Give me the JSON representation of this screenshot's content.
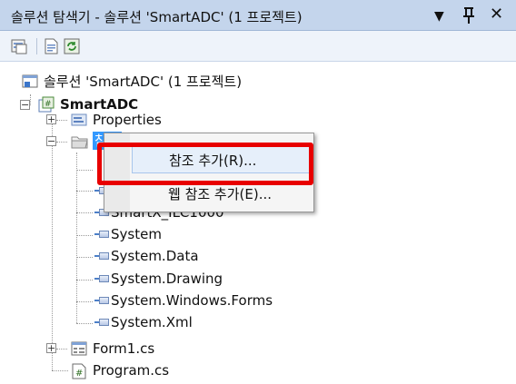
{
  "window": {
    "title": "솔루션 탐색기 - 솔루션 'SmartADC' (1 프로젝트)"
  },
  "title_controls": {
    "dropdown": "▼",
    "pin": "Ț",
    "close": "✕"
  },
  "tree": {
    "solution": "솔루션 'SmartADC' (1 프로젝트)",
    "project": "SmartADC",
    "properties": "Properties",
    "references": "참조",
    "reference_items": [
      "SmartX_ILC1000",
      "System",
      "System.Data",
      "System.Drawing",
      "System.Windows.Forms",
      "System.Xml"
    ],
    "form1": "Form1.cs",
    "program": "Program.cs"
  },
  "context_menu": {
    "items": [
      "참조 추가(R)...",
      "웹 참조 추가(E)..."
    ]
  },
  "colors": {
    "highlight": "#e80000",
    "selection": "#3399ff",
    "title_bar": "#c4d5ec"
  }
}
